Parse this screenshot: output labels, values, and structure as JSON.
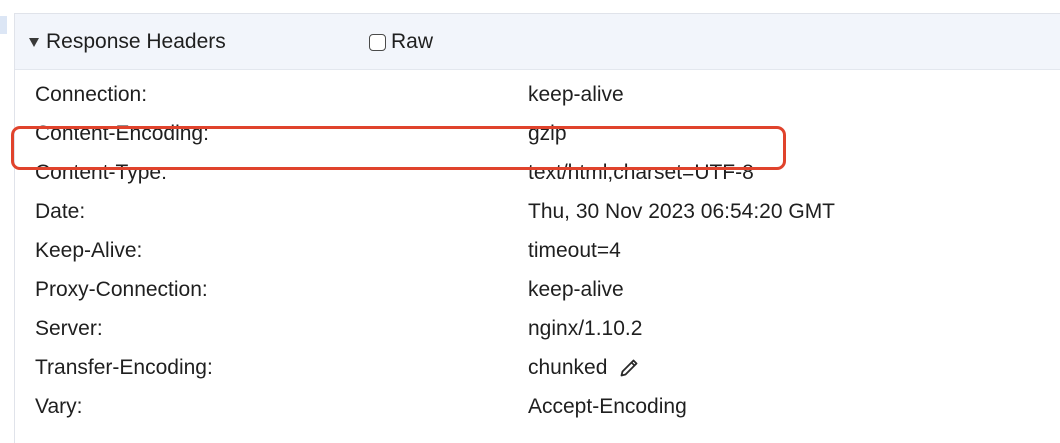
{
  "section": {
    "title": "Response Headers",
    "raw_label": "Raw",
    "raw_checked": false
  },
  "headers": [
    {
      "name": "Connection:",
      "value": "keep-alive"
    },
    {
      "name": "Content-Encoding:",
      "value": "gzip"
    },
    {
      "name": "Content-Type:",
      "value": "text/html;charset=UTF-8"
    },
    {
      "name": "Date:",
      "value": "Thu, 30 Nov 2023 06:54:20 GMT"
    },
    {
      "name": "Keep-Alive:",
      "value": "timeout=4"
    },
    {
      "name": "Proxy-Connection:",
      "value": "keep-alive"
    },
    {
      "name": "Server:",
      "value": "nginx/1.10.2"
    },
    {
      "name": "Transfer-Encoding:",
      "value": "chunked"
    },
    {
      "name": "Vary:",
      "value": "Accept-Encoding"
    }
  ],
  "icons": {
    "toggle": "triangle-down-icon",
    "edit": "pencil-icon"
  },
  "colors": {
    "header_bg": "#f2f5fb",
    "highlight": "#e0432c"
  }
}
